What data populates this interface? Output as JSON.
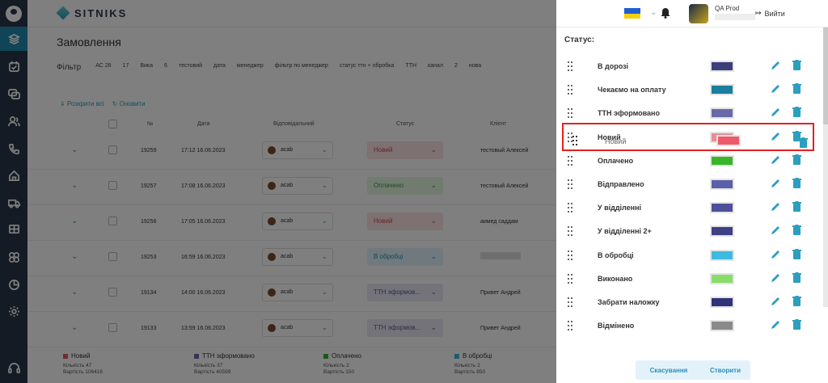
{
  "app": {
    "brand": "SITNIKS",
    "colors": {
      "sidebar": "#2b3648",
      "accent": "#2c9ec0",
      "highlight": "#e32121"
    }
  },
  "header": {
    "user_name": "QA Prod",
    "logout_label": "Вийти",
    "flag": "ukraine-flag"
  },
  "sidebar": {
    "icons": [
      "user-avatar-icon",
      "layers-icon",
      "calendar-icon",
      "chat-icon",
      "users-icon",
      "phone-icon",
      "home-icon",
      "truck-icon",
      "box-icon",
      "integrations-icon",
      "chart-icon",
      "settings-icon",
      "headset-icon"
    ]
  },
  "main": {
    "title": "Замовлення",
    "filter_label": "Фільтр",
    "filters": [
      "АС 28",
      "17",
      "Вика",
      "6",
      "тестовий",
      "дата",
      "менеджер",
      "фільтр по менеджер",
      "статус ттн + обробка",
      "ТТН",
      "канал",
      "2",
      "нова"
    ],
    "tools": {
      "expand_all": "Розкрити всі",
      "refresh": "Оновити"
    },
    "columns": {
      "num": "№",
      "date": "Дата",
      "responsible": "Відповідальний",
      "status": "Статус",
      "client": "Клієнт"
    },
    "rows": [
      {
        "id": "19259",
        "date": "17:12 16.06.2023",
        "resp": "acab",
        "status": "Новий",
        "client": "тестовый Алексей"
      },
      {
        "id": "19257",
        "date": "17:08 16.06.2023",
        "resp": "acab",
        "status": "Оплачено",
        "client": "тестовый Алексей"
      },
      {
        "id": "19256",
        "date": "17:05 16.06.2023",
        "resp": "acab",
        "status": "Новий",
        "client": "аимед саддам"
      },
      {
        "id": "19253",
        "date": "16:59 16.06.2023",
        "resp": "acab",
        "status": "В обробці",
        "client": ""
      },
      {
        "id": "19134",
        "date": "14:00 16.06.2023",
        "resp": "acab",
        "status": "ТТН эформов...",
        "client": "Привет Андрей"
      },
      {
        "id": "19133",
        "date": "13:59 16.06.2023",
        "resp": "acab",
        "status": "ТТН эформов...",
        "client": "Привет Андрей"
      }
    ],
    "summary": [
      {
        "name": "Новий",
        "count": "Кількість 47",
        "sum": "Вартість 106416",
        "color": "#e05a5a"
      },
      {
        "name": "ТТН эформовано",
        "count": "Кількість 37",
        "sum": "Вартість 40599",
        "color": "#6a6aa8"
      },
      {
        "name": "Оплачено",
        "count": "Кількість 2",
        "sum": "Вартість 150",
        "color": "#2fb52f"
      },
      {
        "name": "В обробці",
        "count": "Кількість 2",
        "sum": "Вартість 850",
        "color": "#3fb6d8"
      }
    ]
  },
  "panel": {
    "title": "Статус:",
    "statuses": [
      {
        "name": "В дорозі",
        "color": "#3c3f7a"
      },
      {
        "name": "Чекаємо на оплату",
        "color": "#1a7f9c"
      },
      {
        "name": "ТТН эформовано",
        "color": "#6a6aa8"
      },
      {
        "name": "Новий",
        "color": "#f08a92"
      },
      {
        "name": "Оплачено",
        "color": "#39b52a"
      },
      {
        "name": "Відправлено",
        "color": "#5b5ea8"
      },
      {
        "name": "У відділенні",
        "color": "#4e509a"
      },
      {
        "name": "У відділенні 2+",
        "color": "#3e4184"
      },
      {
        "name": "В обробці",
        "color": "#3fbadf"
      },
      {
        "name": "Виконано",
        "color": "#88dc6a"
      },
      {
        "name": "Забрати наложку",
        "color": "#2f337a"
      },
      {
        "name": "Відмінено",
        "color": "#8a8a8a"
      }
    ],
    "drag_ghost_text": "Новий",
    "cancel_label": "Скасування",
    "create_label": "Створити"
  }
}
